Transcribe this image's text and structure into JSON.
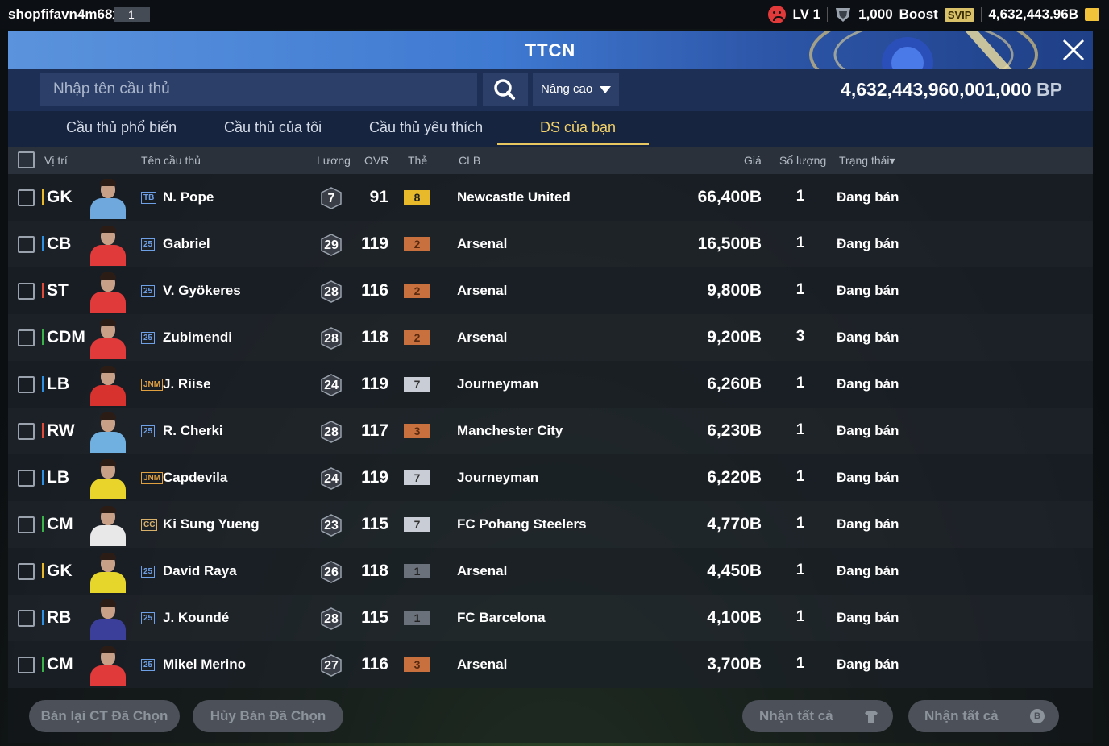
{
  "topbar": {
    "username": "shopfifavn4m68x",
    "badge": "1",
    "level": "LV 1",
    "points": "1,000",
    "boost_label": "Boost",
    "svip_label": "SVIP",
    "coins": "4,632,443.96B"
  },
  "header": {
    "title": "TTCN"
  },
  "search": {
    "placeholder": "Nhập tên cầu thủ",
    "advanced_label": "Nâng cao",
    "bp_amount": "4,632,443,960,001,000",
    "bp_unit": "BP"
  },
  "tabs": [
    {
      "label": "Cầu thủ phổ biến"
    },
    {
      "label": "Cầu thủ của tôi"
    },
    {
      "label": "Cầu thủ yêu thích"
    },
    {
      "label": "DS của bạn",
      "active": true
    }
  ],
  "columns": {
    "position": "Vị trí",
    "player_name": "Tên cầu thủ",
    "wage": "Lương",
    "ovr": "OVR",
    "card": "Thẻ",
    "club": "CLB",
    "price": "Giá",
    "quantity": "Số lượng",
    "status": "Trạng thái"
  },
  "players": [
    {
      "position": "GK",
      "pos_color": "#e8b92a",
      "season": "TB",
      "season_color": "#6ea0e8",
      "name": "N. Pope",
      "wage": "7",
      "ovr": "91",
      "grade": "8",
      "grade_bg": "#e8b92a",
      "grade_fg": "#222",
      "club": "Newcastle United",
      "price": "66,400B",
      "qty": "1",
      "status": "Đang bán",
      "kit": "#6fa8dc"
    },
    {
      "position": "CB",
      "pos_color": "#2f8fe0",
      "season": "25",
      "season_color": "#6ea0e8",
      "name": "Gabriel",
      "wage": "29",
      "ovr": "119",
      "grade": "2",
      "grade_bg": "#c8713f",
      "grade_fg": "#5a2a10",
      "club": "Arsenal",
      "price": "16,500B",
      "qty": "1",
      "status": "Đang bán",
      "kit": "#e03a3a"
    },
    {
      "position": "ST",
      "pos_color": "#e04a3a",
      "season": "25",
      "season_color": "#6ea0e8",
      "name": "V. Gyökeres",
      "wage": "28",
      "ovr": "116",
      "grade": "2",
      "grade_bg": "#c8713f",
      "grade_fg": "#5a2a10",
      "club": "Arsenal",
      "price": "9,800B",
      "qty": "1",
      "status": "Đang bán",
      "kit": "#e03a3a"
    },
    {
      "position": "CDM",
      "pos_color": "#3bb24a",
      "season": "25",
      "season_color": "#6ea0e8",
      "name": "Zubimendi",
      "wage": "28",
      "ovr": "118",
      "grade": "2",
      "grade_bg": "#c8713f",
      "grade_fg": "#5a2a10",
      "club": "Arsenal",
      "price": "9,200B",
      "qty": "3",
      "status": "Đang bán",
      "kit": "#e03a3a"
    },
    {
      "position": "LB",
      "pos_color": "#2f8fe0",
      "season": "JNM",
      "season_color": "#e0a040",
      "name": "J. Riise",
      "wage": "24",
      "ovr": "119",
      "grade": "7",
      "grade_bg": "#c9ced6",
      "grade_fg": "#333",
      "club": "Journeyman",
      "price": "6,260B",
      "qty": "1",
      "status": "Đang bán",
      "kit": "#d8322f"
    },
    {
      "position": "RW",
      "pos_color": "#e04a3a",
      "season": "25",
      "season_color": "#6ea0e8",
      "name": "R. Cherki",
      "wage": "28",
      "ovr": "117",
      "grade": "3",
      "grade_bg": "#c8713f",
      "grade_fg": "#5a2a10",
      "club": "Manchester City",
      "price": "6,230B",
      "qty": "1",
      "status": "Đang bán",
      "kit": "#6fb0e0"
    },
    {
      "position": "LB",
      "pos_color": "#2f8fe0",
      "season": "JNM",
      "season_color": "#e0a040",
      "name": "Capdevila",
      "wage": "24",
      "ovr": "119",
      "grade": "7",
      "grade_bg": "#c9ced6",
      "grade_fg": "#333",
      "club": "Journeyman",
      "price": "6,220B",
      "qty": "1",
      "status": "Đang bán",
      "kit": "#e8d42a"
    },
    {
      "position": "CM",
      "pos_color": "#3bb24a",
      "season": "CC",
      "season_color": "#d9b06a",
      "name": "Ki Sung Yueng",
      "wage": "23",
      "ovr": "115",
      "grade": "7",
      "grade_bg": "#c9ced6",
      "grade_fg": "#333",
      "club": "FC Pohang Steelers",
      "price": "4,770B",
      "qty": "1",
      "status": "Đang bán",
      "kit": "#e8e8e8"
    },
    {
      "position": "GK",
      "pos_color": "#e8b92a",
      "season": "25",
      "season_color": "#6ea0e8",
      "name": "David Raya",
      "wage": "26",
      "ovr": "118",
      "grade": "1",
      "grade_bg": "#6b717a",
      "grade_fg": "#222",
      "club": "Arsenal",
      "price": "4,450B",
      "qty": "1",
      "status": "Đang bán",
      "kit": "#e6d62c"
    },
    {
      "position": "RB",
      "pos_color": "#2f8fe0",
      "season": "25",
      "season_color": "#6ea0e8",
      "name": "J. Koundé",
      "wage": "28",
      "ovr": "115",
      "grade": "1",
      "grade_bg": "#6b717a",
      "grade_fg": "#222",
      "club": "FC Barcelona",
      "price": "4,100B",
      "qty": "1",
      "status": "Đang bán",
      "kit": "#3c3f9a"
    },
    {
      "position": "CM",
      "pos_color": "#3bb24a",
      "season": "25",
      "season_color": "#6ea0e8",
      "name": "Mikel Merino",
      "wage": "27",
      "ovr": "116",
      "grade": "3",
      "grade_bg": "#c8713f",
      "grade_fg": "#5a2a10",
      "club": "Arsenal",
      "price": "3,700B",
      "qty": "1",
      "status": "Đang bán",
      "kit": "#e03a3a"
    }
  ],
  "footer": {
    "resell_selected": "Bán lại CT Đã Chọn",
    "cancel_selected": "Hủy Bán Đã Chọn",
    "claim_all_1": "Nhận tất cả",
    "claim_all_2": "Nhận tất cả",
    "claim_icon_2": "B"
  }
}
